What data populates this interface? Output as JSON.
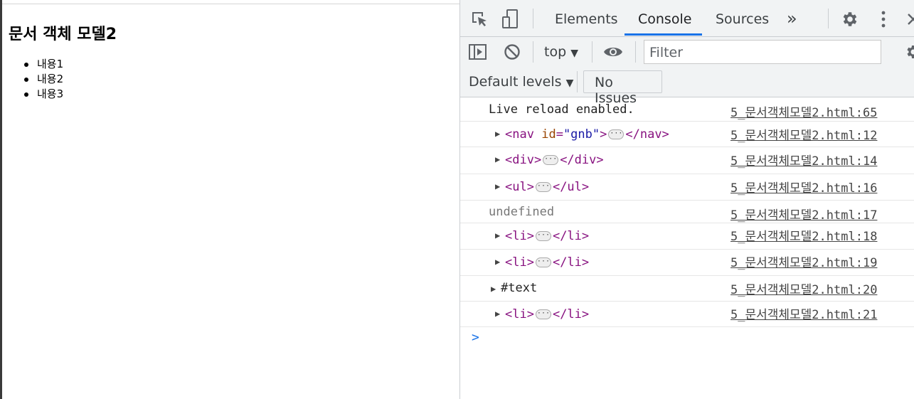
{
  "page": {
    "heading": "문서 객체 모델2",
    "items": [
      "내용1",
      "내용2",
      "내용3"
    ]
  },
  "devtools": {
    "tabs": [
      {
        "label": "Elements",
        "active": false
      },
      {
        "label": "Console",
        "active": true
      },
      {
        "label": "Sources",
        "active": false
      }
    ],
    "more_tabs_icon": "»",
    "context": "top",
    "filter_placeholder": "Filter",
    "levels_label": "Default levels",
    "issues_label": "No Issues",
    "accent_color": "#1a73e8"
  },
  "console": {
    "rows": [
      {
        "type": "text",
        "text": "Live reload enabled.",
        "source": "5_문서객체모델2.html:65"
      },
      {
        "type": "element",
        "open": "<nav",
        "attr_name": "id",
        "attr_value": "\"gnb\"",
        "open_end": ">",
        "close": "</nav>",
        "source": "5_문서객체모델2.html:12"
      },
      {
        "type": "element",
        "open": "<div>",
        "close": "</div>",
        "source": "5_문서객체모델2.html:14"
      },
      {
        "type": "element",
        "open": "<ul>",
        "close": "</ul>",
        "source": "5_문서객체모델2.html:16"
      },
      {
        "type": "undefined",
        "text": "undefined",
        "source": "5_문서객체모델2.html:17"
      },
      {
        "type": "element",
        "open": "<li>",
        "close": "</li>",
        "source": "5_문서객체모델2.html:18"
      },
      {
        "type": "element",
        "open": "<li>",
        "close": "</li>",
        "source": "5_문서객체모델2.html:19"
      },
      {
        "type": "textnode",
        "text": "#text",
        "source": "5_문서객체모델2.html:20"
      },
      {
        "type": "element",
        "open": "<li>",
        "close": "</li>",
        "source": "5_문서객체모델2.html:21"
      }
    ],
    "prompt_symbol": ">"
  }
}
